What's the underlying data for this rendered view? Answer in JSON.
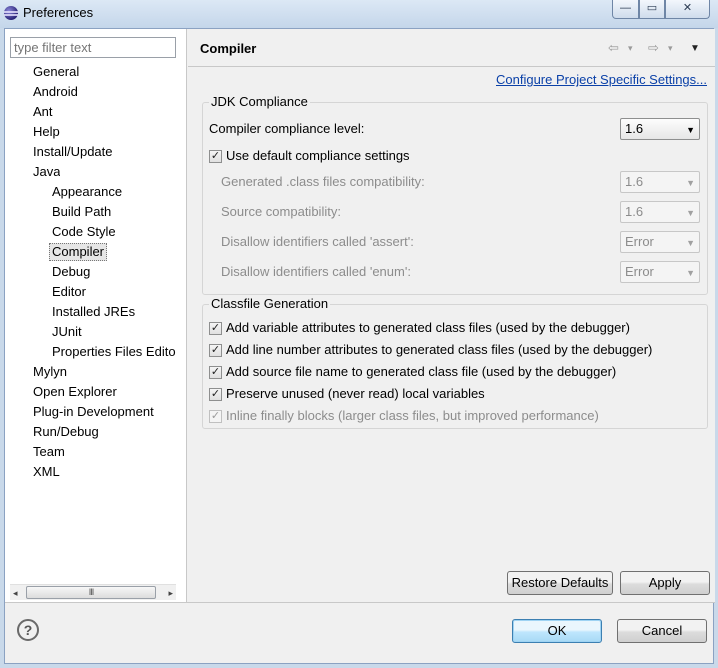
{
  "window": {
    "title": "Preferences",
    "min_glyph": "—",
    "max_glyph": "▭",
    "close_glyph": "✕"
  },
  "filter": {
    "placeholder": "type filter text"
  },
  "tree": [
    {
      "label": "General",
      "level": 0
    },
    {
      "label": "Android",
      "level": 0
    },
    {
      "label": "Ant",
      "level": 0
    },
    {
      "label": "Help",
      "level": 0
    },
    {
      "label": "Install/Update",
      "level": 0
    },
    {
      "label": "Java",
      "level": 0
    },
    {
      "label": "Appearance",
      "level": 1
    },
    {
      "label": "Build Path",
      "level": 1
    },
    {
      "label": "Code Style",
      "level": 1
    },
    {
      "label": "Compiler",
      "level": 1,
      "selected": true
    },
    {
      "label": "Debug",
      "level": 1
    },
    {
      "label": "Editor",
      "level": 1
    },
    {
      "label": "Installed JREs",
      "level": 1
    },
    {
      "label": "JUnit",
      "level": 1
    },
    {
      "label": "Properties Files Edito",
      "level": 1
    },
    {
      "label": "Mylyn",
      "level": 0
    },
    {
      "label": "Open Explorer",
      "level": 0
    },
    {
      "label": "Plug-in Development",
      "level": 0
    },
    {
      "label": "Run/Debug",
      "level": 0
    },
    {
      "label": "Team",
      "level": 0
    },
    {
      "label": "XML",
      "level": 0
    }
  ],
  "scrollbar": {
    "left": "◂",
    "right": "▸",
    "grip": "III"
  },
  "page": {
    "title": "Compiler",
    "nav": {
      "back": "⇦",
      "back_menu": "▾",
      "forward": "⇨",
      "forward_menu": "▾",
      "view_menu": "▼"
    },
    "config_link": "Configure Project Specific Settings..."
  },
  "jdk": {
    "title": "JDK Compliance",
    "compliance_label": "Compiler compliance level:",
    "compliance_value": "1.6",
    "use_default_label": "Use default compliance settings",
    "use_default_checked": true,
    "generated_label": "Generated .class files compatibility:",
    "generated_value": "1.6",
    "source_label": "Source compatibility:",
    "source_value": "1.6",
    "assert_label": "Disallow identifiers called 'assert':",
    "assert_value": "Error",
    "enum_label": "Disallow identifiers called 'enum':",
    "enum_value": "Error"
  },
  "classfile": {
    "title": "Classfile Generation",
    "options": [
      {
        "label": "Add variable attributes to generated class files (used by the debugger)",
        "checked": true,
        "enabled": true
      },
      {
        "label": "Add line number attributes to generated class files (used by the debugger)",
        "checked": true,
        "enabled": true
      },
      {
        "label": "Add source file name to generated class file (used by the debugger)",
        "checked": true,
        "enabled": true
      },
      {
        "label": "Preserve unused (never read) local variables",
        "checked": true,
        "enabled": true
      },
      {
        "label": "Inline finally blocks (larger class files, but improved performance)",
        "checked": true,
        "enabled": false
      }
    ]
  },
  "buttons": {
    "restore": "Restore Defaults",
    "apply": "Apply",
    "ok": "OK",
    "cancel": "Cancel"
  },
  "help": {
    "glyph": "?"
  },
  "glyphs": {
    "check": "✓",
    "dropdown": "▼"
  }
}
